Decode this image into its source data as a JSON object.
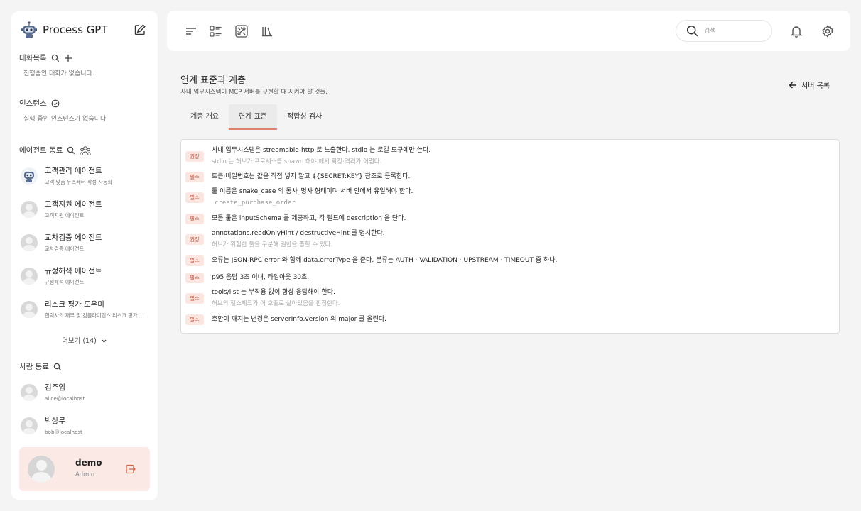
{
  "app": {
    "name": "Process GPT"
  },
  "sidebar": {
    "chats": {
      "title": "대화목록",
      "empty": "진행중인 대화가 없습니다."
    },
    "instances": {
      "title": "인스턴스",
      "empty": "실행 중인 인스턴스가 없습니다"
    },
    "agents": {
      "title": "에이전트 동료",
      "items": [
        {
          "name": "고객관리 에이전트",
          "desc": "고객 맞춤 뉴스레터 작성 자동화"
        },
        {
          "name": "고객지원 에이전트",
          "desc": "고객지원 에이전트"
        },
        {
          "name": "교차검증 에이전트",
          "desc": "교차검증 에이전트"
        },
        {
          "name": "규정해석 에이전트",
          "desc": "규정해석 에이전트"
        },
        {
          "name": "리스크 평가 도우미",
          "desc": "협력사의 재무 및 컴플라이언스 리스크 평가 보조"
        }
      ],
      "more": "더보기 (14)"
    },
    "people": {
      "title": "사람 동료",
      "items": [
        {
          "name": "김주임",
          "email": "alice@localhost"
        },
        {
          "name": "박상무",
          "email": "bob@localhost"
        }
      ]
    },
    "user": {
      "name": "demo",
      "role": "Admin"
    }
  },
  "topbar": {
    "search_placeholder": "검색"
  },
  "page": {
    "title": "연계 표준과 계층",
    "subtitle": "사내 업무시스템이 MCP 서버를 구현할 때 지켜야 할 것들.",
    "back_label": "서버 목록",
    "tabs": [
      "계층 개요",
      "연계 표준",
      "적합성 검사"
    ],
    "active_tab": 1
  },
  "rules": [
    {
      "badge": "권장",
      "text": "사내 업무시스템은 streamable-http 로 노출한다. stdio 는 로컬 도구에만 쓴다.",
      "sub": "stdio 는 허브가 프로세스를 spawn 해야 해서 확장·격리가 어렵다."
    },
    {
      "badge": "필수",
      "text": "토큰·비밀번호는 값을 직접 넣지 말고 ${SECRET:KEY} 참조로 등록한다.",
      "sub": ""
    },
    {
      "badge": "필수",
      "text": "툴 이름은 snake_case 의 동사_명사 형태이며 서버 안에서 유일해야 한다.",
      "code": "create_purchase_order"
    },
    {
      "badge": "필수",
      "text": "모든 툴은 inputSchema 를 제공하고, 각 필드에 description 을 단다.",
      "sub": ""
    },
    {
      "badge": "권장",
      "text": "annotations.readOnlyHint / destructiveHint 를 명시한다.",
      "sub": "허브가 위험한 툴을 구분해 권한을 좁힐 수 있다."
    },
    {
      "badge": "필수",
      "text": "오류는 JSON-RPC error 와 함께 data.errorType 을 준다. 분류는 AUTH · VALIDATION · UPSTREAM · TIMEOUT 중 하나.",
      "sub": ""
    },
    {
      "badge": "필수",
      "text": "p95 응답 3초 이내, 타임아웃 30초.",
      "sub": ""
    },
    {
      "badge": "필수",
      "text": "tools/list 는 부작용 없이 항상 응답해야 한다.",
      "sub": "허브의 헬스체크가 이 호출로 살아있음을 판정한다."
    },
    {
      "badge": "필수",
      "text": "호환이 깨지는 변경은 serverInfo.version 의 major 를 올린다.",
      "sub": ""
    }
  ]
}
